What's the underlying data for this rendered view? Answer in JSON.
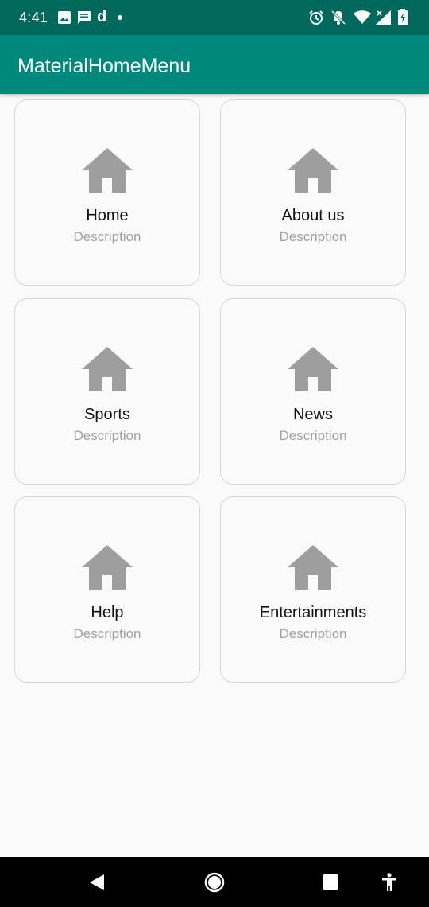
{
  "status_bar": {
    "time": "4:41",
    "left_icons": [
      "image-icon",
      "message-icon",
      "d-app-icon",
      "dot-icon"
    ],
    "d_glyph": "d",
    "right_icons": [
      "alarm-icon",
      "notifications-off-icon",
      "wifi-icon",
      "signal-icon",
      "battery-icon"
    ]
  },
  "app_bar": {
    "title": "MaterialHomeMenu",
    "color": "#00897b",
    "status_color": "#00695c"
  },
  "menu": {
    "icon": "home-icon",
    "icon_color": "#9e9e9e",
    "items": [
      {
        "title": "Home",
        "description": "Description"
      },
      {
        "title": "About us",
        "description": "Description"
      },
      {
        "title": "Sports",
        "description": "Description"
      },
      {
        "title": "News",
        "description": "Description"
      },
      {
        "title": "Help",
        "description": "Description"
      },
      {
        "title": "Entertainments",
        "description": "Description"
      }
    ]
  },
  "nav_bar": {
    "buttons": [
      "back-icon",
      "home-circle-icon",
      "recents-icon",
      "accessibility-icon"
    ]
  }
}
